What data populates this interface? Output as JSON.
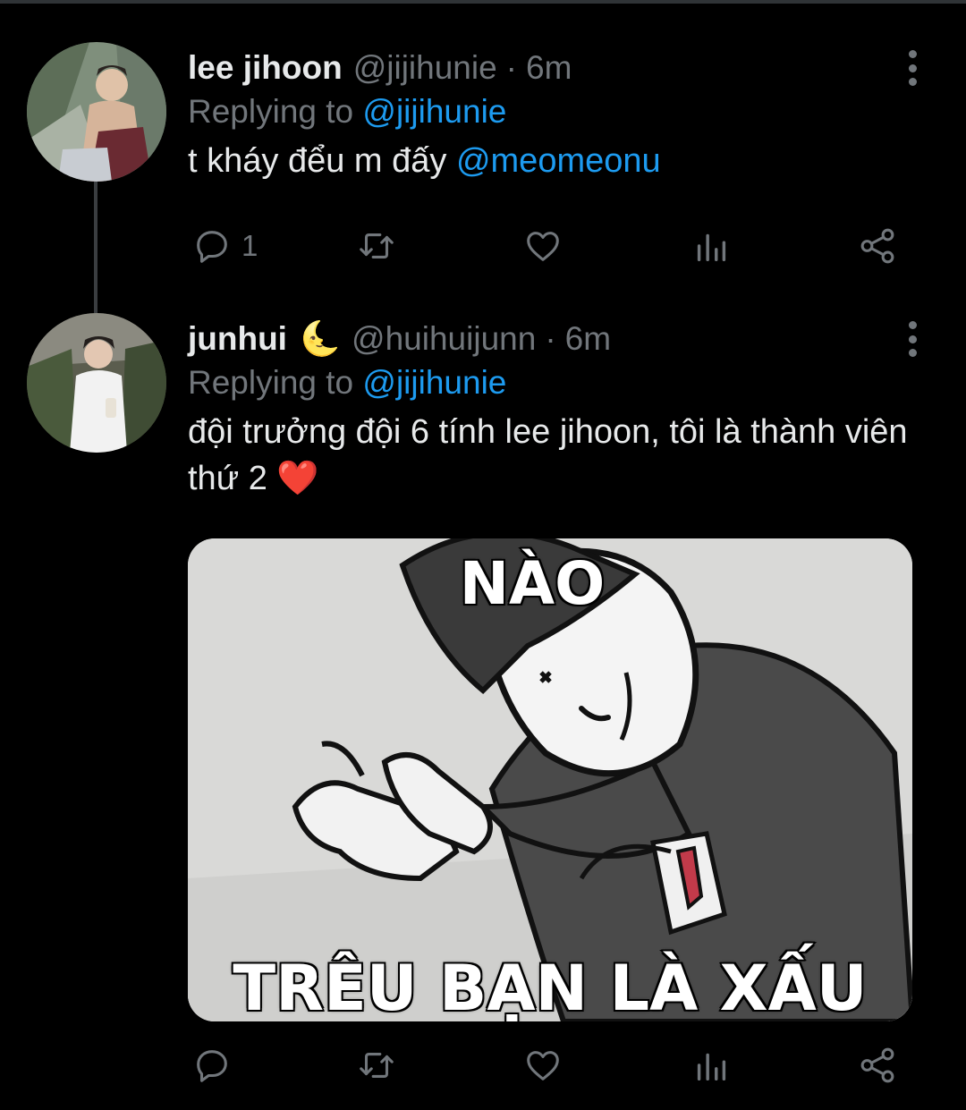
{
  "tweets": [
    {
      "name": "lee jihoon",
      "name_emoji": "",
      "handle": "@jijihunie",
      "separator": "·",
      "time": "6m",
      "replying_prefix": "Replying to",
      "replying_to": "@jijihunie",
      "text": "t kháy đểu m đấy",
      "text_mention": "@meomeonu",
      "reply_count": "1"
    },
    {
      "name": "junhui",
      "name_emoji": "🌜",
      "handle": "@huihuijunn",
      "separator": "·",
      "time": "6m",
      "replying_prefix": "Replying to",
      "replying_to": "@jijihunie",
      "text": "đội trưởng đội 6 tính lee jihoon, tôi là thành viên thứ 2 ❤️",
      "media_caption_top": "NÀO",
      "media_caption_bottom": "TRÊU BẠN LÀ XẤU"
    }
  ],
  "icons": [
    "reply-icon",
    "retweet-icon",
    "like-icon",
    "analytics-icon",
    "share-icon",
    "more-icon"
  ],
  "colors": {
    "background": "#000000",
    "text": "#e7e9ea",
    "secondary": "#71767b",
    "accent": "#1d9bf0",
    "thread_line": "#3a3d40"
  }
}
